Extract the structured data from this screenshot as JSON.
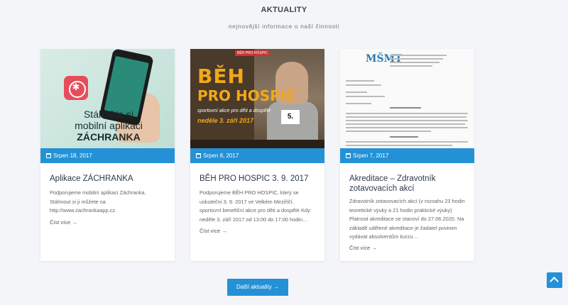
{
  "section": {
    "title": "AKTUALITY",
    "subtitle": "nejnovější informace o naší činnosti"
  },
  "cards": [
    {
      "date": "Srpen 18, 2017",
      "title": "Aplikace ZÁCHRANKA",
      "text": "Podporujeme mobilní aplikaci Záchranka. Stáhnout si ji můžete na http://www.zachrankaapp.cz.",
      "read_more": "Číst více →",
      "image_text_line1": "Stáhněte si",
      "image_text_line2": "mobilní aplikaci",
      "image_text_line3": "ZÁCHRANKA"
    },
    {
      "date": "Srpen 8, 2017",
      "title": "BĚH PRO HOSPIC 3. 9. 2017",
      "text": "Podporujeme BĚH PRO HOSPIC, který se uskuteční 3. 9. 2017 ve Velkém Meziříčí. sportovní benefiční akce pro děti a dospělé Kdy: neděle 3. září 2017 od 13:00 do 17:00 hodin…",
      "read_more": "Číst více →",
      "image_heading1": "BĚH",
      "image_heading2": "PRO HOSPIC",
      "image_sub": "sportovní akce pro děti a dospělé",
      "image_date": "neděle 3. září 2017",
      "image_bib": "5.",
      "image_logo": "BĚH PRO HOSPIC"
    },
    {
      "date": "Srpen 7, 2017",
      "title": "Akreditace – Zdravotník zotavovacích akcí",
      "text": "Zdravotník zotavovacích akcí (v rozsahu 23 hodin teoretické výuky a 21 hodin praktické výuky) Platnost akreditace se stanoví do 27.06.2020. Na základě udělené akreditace je žadatel povinen vydávat absolventům kurzu…",
      "read_more": "Číst více →",
      "image_logo": "MŠMT"
    }
  ],
  "more_button": "Další aktuality →",
  "colors": {
    "accent": "#2491d6",
    "orange": "#f2a81a"
  },
  "icons": {
    "date": "calendar-icon",
    "scroll": "chevron-up-icon"
  }
}
